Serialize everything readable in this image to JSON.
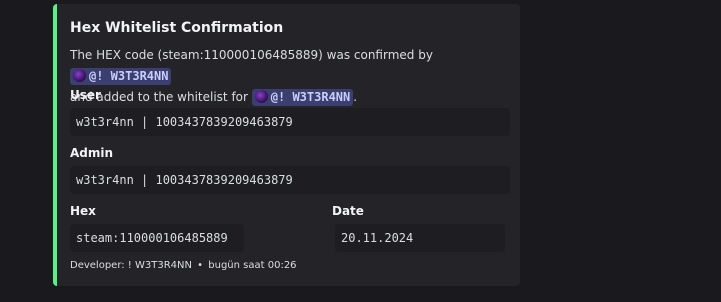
{
  "embed": {
    "accent_color": "#57f287",
    "title": "Hex Whitelist Confirmation",
    "description": {
      "part1": "The HEX code (steam:110000106485889) was confirmed by",
      "mention1": "@! W3T3R4NN",
      "part2": "and added to the whitelist for",
      "mention2": "@! W3T3R4NN",
      "part3": "."
    },
    "fields": {
      "user": {
        "label": "User",
        "value": "w3t3r4nn | 1003437839209463879"
      },
      "admin": {
        "label": "Admin",
        "value": "w3t3r4nn | 1003437839209463879"
      },
      "hex": {
        "label": "Hex",
        "value": "steam:110000106485889"
      },
      "date": {
        "label": "Date",
        "value": "20.11.2024"
      }
    },
    "footer": {
      "text": "Developer: ! W3T3R4NN",
      "separator": "•",
      "timestamp": "bugün saat 00:26"
    }
  }
}
